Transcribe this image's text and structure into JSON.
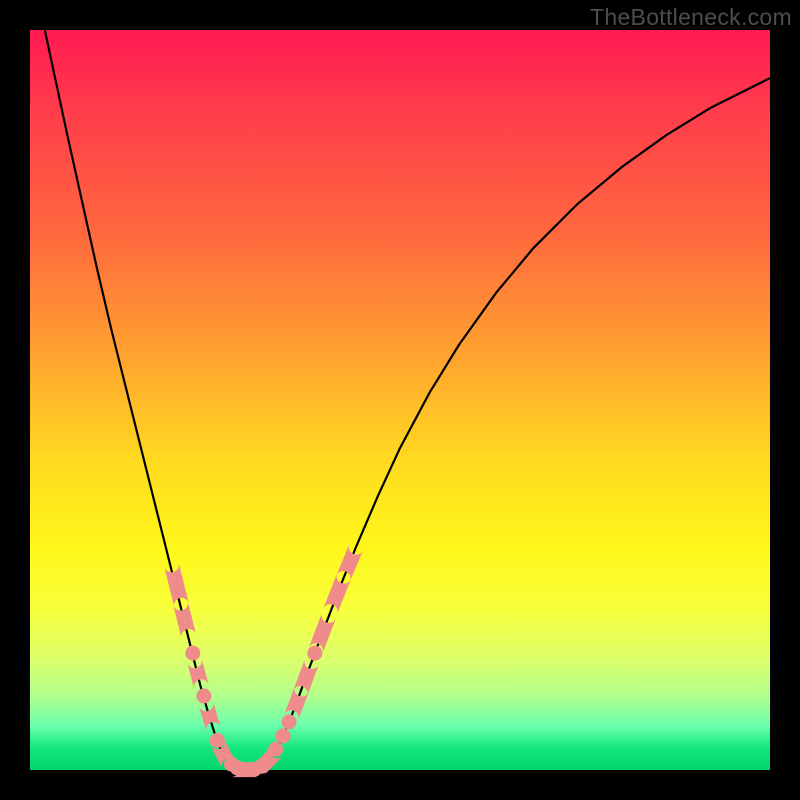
{
  "watermark": "TheBottleneck.com",
  "chart_data": {
    "type": "line",
    "title": "",
    "xlabel": "",
    "ylabel": "",
    "xlim": [
      0,
      100
    ],
    "ylim": [
      0,
      100
    ],
    "curve_points": [
      {
        "x": 2.0,
        "y": 100.0
      },
      {
        "x": 3.5,
        "y": 93.0
      },
      {
        "x": 5.0,
        "y": 86.0
      },
      {
        "x": 7.0,
        "y": 77.0
      },
      {
        "x": 9.0,
        "y": 68.0
      },
      {
        "x": 11.0,
        "y": 59.5
      },
      {
        "x": 13.0,
        "y": 51.5
      },
      {
        "x": 15.0,
        "y": 43.5
      },
      {
        "x": 16.5,
        "y": 37.5
      },
      {
        "x": 18.0,
        "y": 31.5
      },
      {
        "x": 19.5,
        "y": 25.5
      },
      {
        "x": 21.0,
        "y": 19.5
      },
      {
        "x": 22.0,
        "y": 15.5
      },
      {
        "x": 23.0,
        "y": 11.5
      },
      {
        "x": 24.0,
        "y": 8.0
      },
      {
        "x": 25.0,
        "y": 4.8
      },
      {
        "x": 26.0,
        "y": 2.2
      },
      {
        "x": 27.0,
        "y": 0.8
      },
      {
        "x": 28.0,
        "y": 0.2
      },
      {
        "x": 29.0,
        "y": 0.0
      },
      {
        "x": 30.0,
        "y": 0.0
      },
      {
        "x": 31.0,
        "y": 0.3
      },
      {
        "x": 32.0,
        "y": 1.0
      },
      {
        "x": 33.0,
        "y": 2.3
      },
      {
        "x": 34.0,
        "y": 4.2
      },
      {
        "x": 35.0,
        "y": 6.5
      },
      {
        "x": 36.0,
        "y": 9.0
      },
      {
        "x": 37.0,
        "y": 11.8
      },
      {
        "x": 38.5,
        "y": 15.8
      },
      {
        "x": 40.0,
        "y": 19.8
      },
      {
        "x": 42.0,
        "y": 25.0
      },
      {
        "x": 44.0,
        "y": 30.0
      },
      {
        "x": 47.0,
        "y": 37.0
      },
      {
        "x": 50.0,
        "y": 43.5
      },
      {
        "x": 54.0,
        "y": 51.0
      },
      {
        "x": 58.0,
        "y": 57.5
      },
      {
        "x": 63.0,
        "y": 64.5
      },
      {
        "x": 68.0,
        "y": 70.5
      },
      {
        "x": 74.0,
        "y": 76.5
      },
      {
        "x": 80.0,
        "y": 81.5
      },
      {
        "x": 86.0,
        "y": 85.8
      },
      {
        "x": 92.0,
        "y": 89.5
      },
      {
        "x": 98.0,
        "y": 92.5
      },
      {
        "x": 100.0,
        "y": 93.5
      }
    ],
    "markers": [
      {
        "x": 19.8,
        "y": 25.0,
        "shape": "pill",
        "len": 4.0
      },
      {
        "x": 20.9,
        "y": 20.3,
        "shape": "pill",
        "len": 3.0
      },
      {
        "x": 22.0,
        "y": 15.8,
        "shape": "dot"
      },
      {
        "x": 22.7,
        "y": 13.0,
        "shape": "pill",
        "len": 2.0
      },
      {
        "x": 23.5,
        "y": 10.0,
        "shape": "dot"
      },
      {
        "x": 24.3,
        "y": 7.2,
        "shape": "pill",
        "len": 2.0
      },
      {
        "x": 25.3,
        "y": 4.0,
        "shape": "dot"
      },
      {
        "x": 26.1,
        "y": 2.2,
        "shape": "pill",
        "len": 2.0
      },
      {
        "x": 27.2,
        "y": 0.8,
        "shape": "dot"
      },
      {
        "x": 28.0,
        "y": 0.3,
        "shape": "dot"
      },
      {
        "x": 29.0,
        "y": 0.05,
        "shape": "pill-h",
        "len": 2.0
      },
      {
        "x": 30.3,
        "y": 0.1,
        "shape": "dot"
      },
      {
        "x": 31.3,
        "y": 0.5,
        "shape": "dot"
      },
      {
        "x": 32.2,
        "y": 1.3,
        "shape": "pill",
        "len": 2.0
      },
      {
        "x": 33.2,
        "y": 2.8,
        "shape": "dot"
      },
      {
        "x": 34.2,
        "y": 4.6,
        "shape": "dot"
      },
      {
        "x": 35.0,
        "y": 6.5,
        "shape": "dot"
      },
      {
        "x": 36.0,
        "y": 9.0,
        "shape": "pill",
        "len": 2.5
      },
      {
        "x": 37.3,
        "y": 12.5,
        "shape": "pill",
        "len": 3.0
      },
      {
        "x": 38.5,
        "y": 15.8,
        "shape": "dot"
      },
      {
        "x": 39.5,
        "y": 18.5,
        "shape": "pill",
        "len": 3.5
      },
      {
        "x": 41.5,
        "y": 23.8,
        "shape": "pill",
        "len": 3.5
      },
      {
        "x": 43.2,
        "y": 28.0,
        "shape": "pill",
        "len": 3.0
      }
    ],
    "gradient_colors": {
      "top": "#ff1a52",
      "mid_upper": "#ffa62e",
      "mid": "#fff71a",
      "mid_lower": "#b2ff8b",
      "bottom": "#00d46a"
    }
  }
}
